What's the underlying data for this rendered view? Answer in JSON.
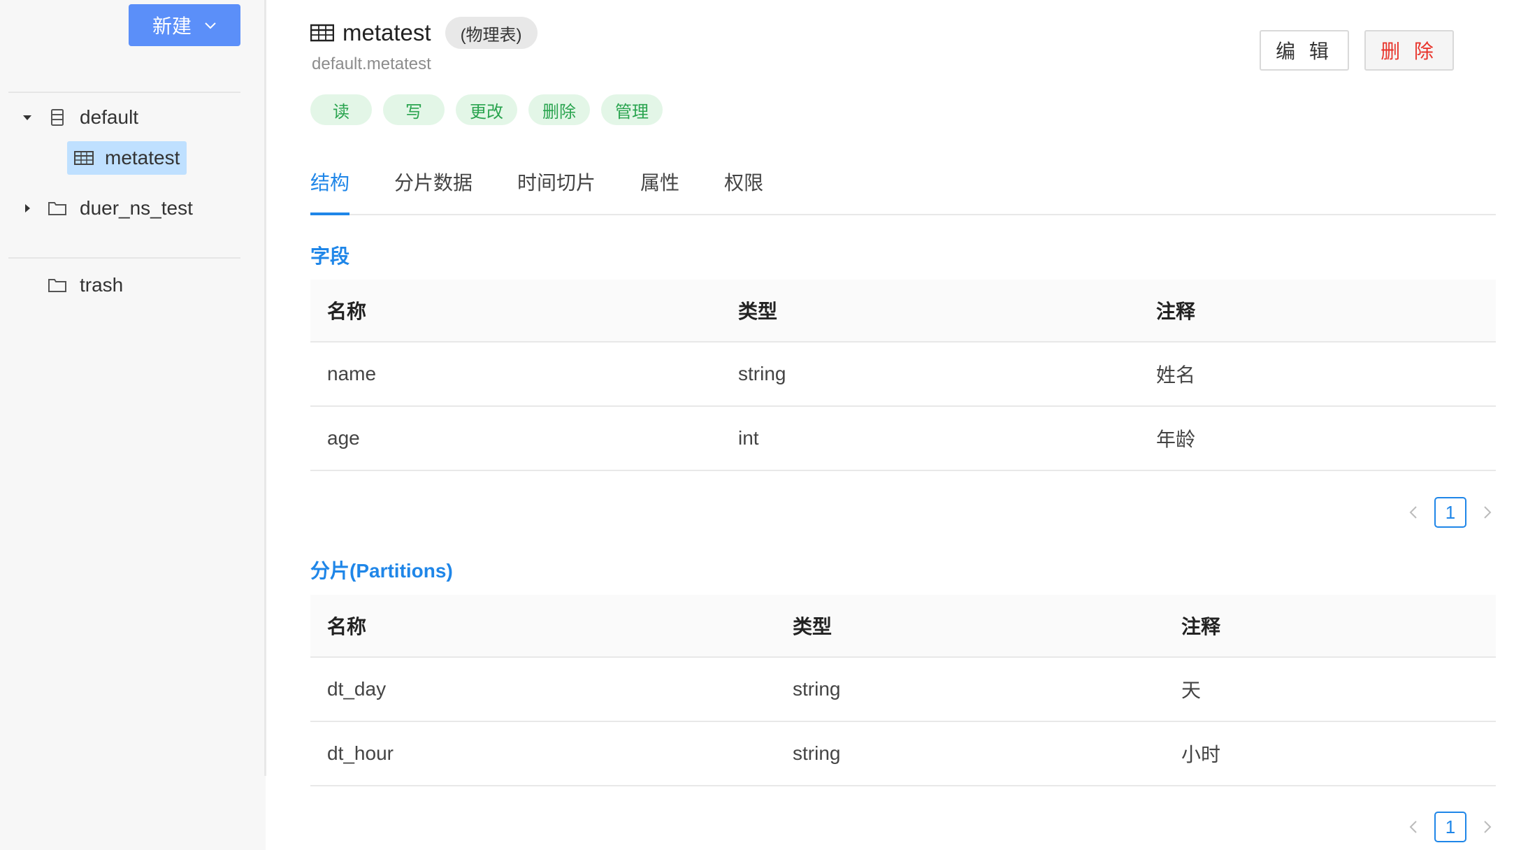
{
  "sidebar": {
    "new_button_label": "新建",
    "tree": {
      "default_label": "default",
      "metatest_label": "metatest",
      "duer_label": "duer_ns_test",
      "trash_label": "trash"
    }
  },
  "header": {
    "title": "metatest",
    "type_badge": "(物理表)",
    "subtitle": "default.metatest",
    "permissions": [
      "读",
      "写",
      "更改",
      "删除",
      "管理"
    ],
    "edit_label": "编 辑",
    "delete_label": "删 除"
  },
  "tabs": [
    "结构",
    "分片数据",
    "时间切片",
    "属性",
    "权限"
  ],
  "fields_section": {
    "title": "字段",
    "columns": [
      "名称",
      "类型",
      "注释"
    ],
    "rows": [
      [
        "name",
        "string",
        "姓名"
      ],
      [
        "age",
        "int",
        "年龄"
      ]
    ],
    "page": "1"
  },
  "partitions_section": {
    "title": "分片(Partitions)",
    "columns": [
      "名称",
      "类型",
      "注释"
    ],
    "rows": [
      [
        "dt_day",
        "string",
        "天"
      ],
      [
        "dt_hour",
        "string",
        "小时"
      ]
    ],
    "page": "1"
  },
  "colors": {
    "accent": "#1f86e8",
    "new_button": "#5b8ff9",
    "permission_text": "#2aa44f",
    "permission_bg": "#e3f6e7",
    "danger": "#e8352c",
    "selected_bg": "#bfe0ff"
  }
}
